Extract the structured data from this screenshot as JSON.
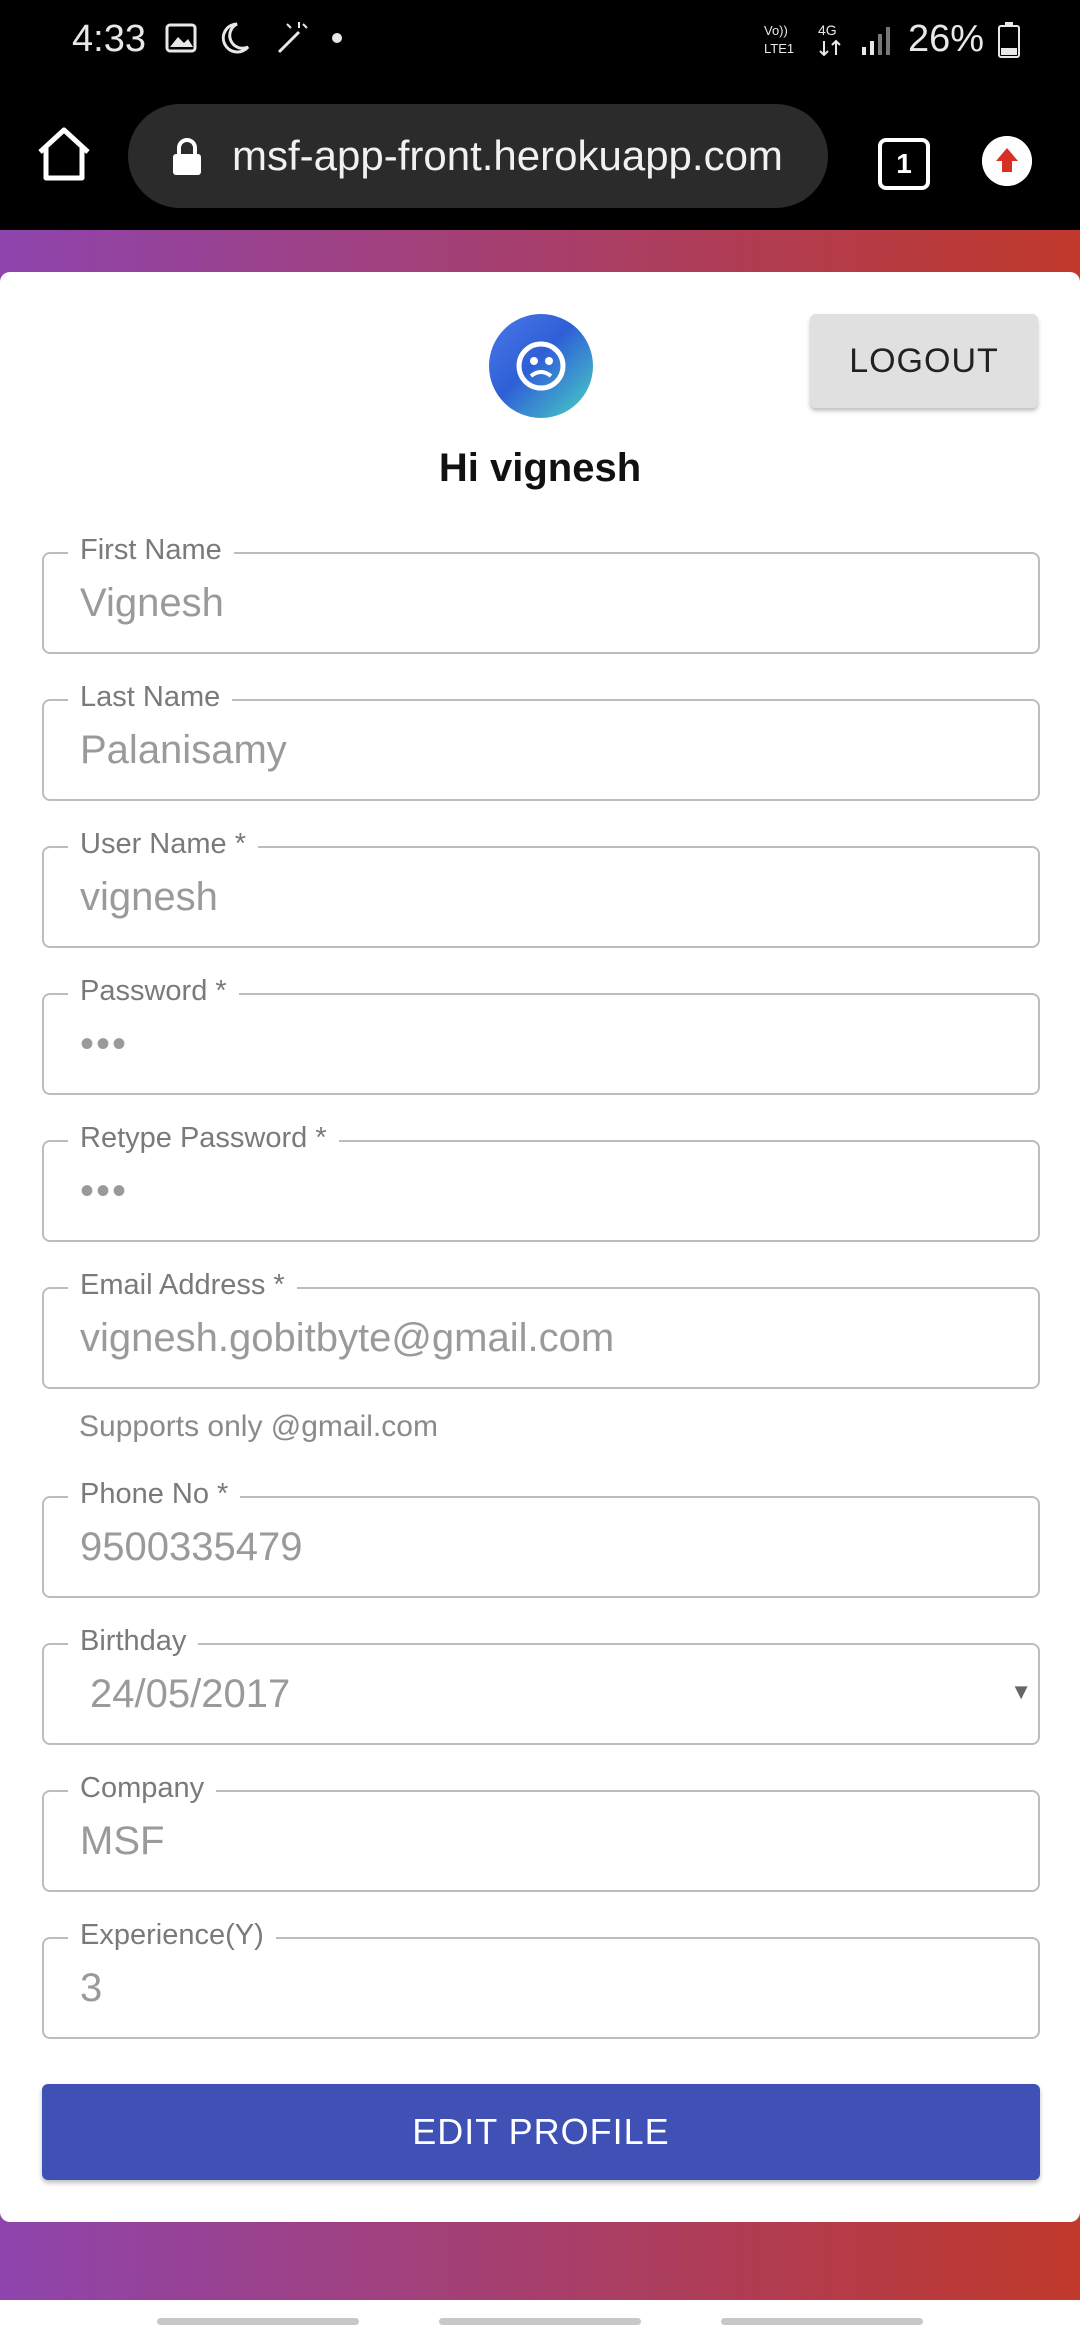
{
  "status_bar": {
    "time": "4:33",
    "network": "Vo) LTE1 4G",
    "battery": "26%"
  },
  "browser": {
    "url": "msf-app-front.herokuapp.com",
    "tab_count": "1"
  },
  "header": {
    "logout_label": "LOGOUT",
    "greeting": "Hi vignesh"
  },
  "form": {
    "first_name": {
      "label": "First Name",
      "value": "Vignesh"
    },
    "last_name": {
      "label": "Last Name",
      "value": "Palanisamy"
    },
    "user_name": {
      "label": "User Name *",
      "value": "vignesh"
    },
    "password": {
      "label": "Password *",
      "value": "•••"
    },
    "retype_password": {
      "label": "Retype Password *",
      "value": "•••"
    },
    "email": {
      "label": "Email Address *",
      "value": "vignesh.gobitbyte@gmail.com",
      "helper": "Supports only @gmail.com"
    },
    "phone": {
      "label": "Phone No *",
      "value": "9500335479"
    },
    "birthday": {
      "label": "Birthday",
      "value": "24/05/2017"
    },
    "company": {
      "label": "Company",
      "value": "MSF"
    },
    "experience": {
      "label": "Experience(Y)",
      "value": "3"
    }
  },
  "actions": {
    "edit_profile_label": "EDIT PROFILE"
  },
  "colors": {
    "primary": "#3f51b5",
    "gradient_start": "#8e44ad",
    "gradient_end": "#c0392b"
  }
}
